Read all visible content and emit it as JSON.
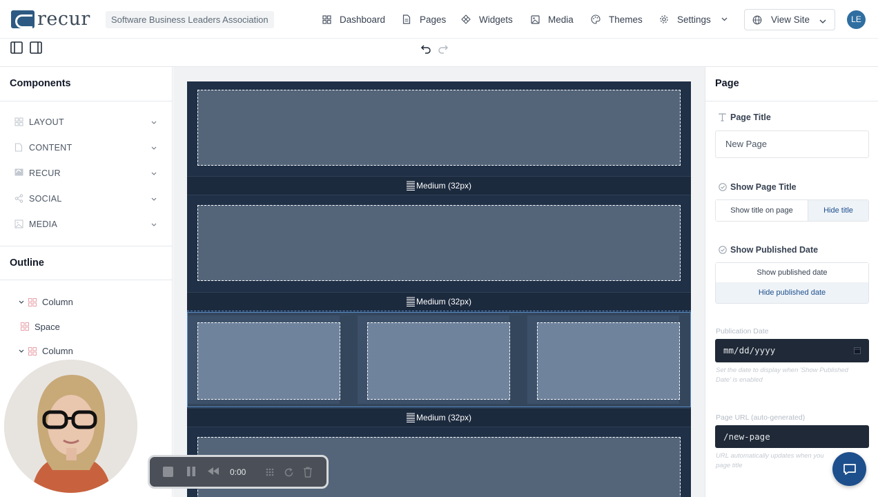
{
  "brand": {
    "logo_text": "recur",
    "org_name": "Software Business Leaders Association"
  },
  "nav": {
    "dashboard": "Dashboard",
    "pages": "Pages",
    "widgets": "Widgets",
    "media": "Media",
    "themes": "Themes",
    "settings": "Settings",
    "view_site": "View Site",
    "avatar_initials": "LE"
  },
  "left_panel": {
    "components_title": "Components",
    "components": [
      {
        "label": "LAYOUT",
        "icon": "layout-grid-icon"
      },
      {
        "label": "CONTENT",
        "icon": "document-icon"
      },
      {
        "label": "RECUR",
        "icon": "recur-icon"
      },
      {
        "label": "SOCIAL",
        "icon": "share-icon"
      },
      {
        "label": "MEDIA",
        "icon": "image-icon"
      }
    ],
    "outline_title": "Outline",
    "outline": [
      {
        "label": "Column",
        "expandable": true
      },
      {
        "label": "Space",
        "expandable": false
      },
      {
        "label": "Column",
        "expandable": true
      }
    ]
  },
  "canvas": {
    "spacer_label": "Medium (32px)"
  },
  "right_panel": {
    "title": "Page",
    "page_title_label": "Page Title",
    "page_title_value": "New Page",
    "show_page_title_label": "Show Page Title",
    "show_title_option": "Show title on page",
    "hide_title_option": "Hide title",
    "show_published_date_label": "Show Published Date",
    "show_published_option": "Show published date",
    "hide_published_option": "Hide published date",
    "publication_date_label": "Publication Date",
    "publication_date_placeholder": "mm/dd/yyyy",
    "publication_date_help": "Set the date to display when 'Show Published Date' is enabled",
    "page_url_label": "Page URL (auto-generated)",
    "page_url_value": "/new-page",
    "page_url_help_1": "URL automatically updates when you",
    "page_url_help_2": "page title"
  },
  "recorder": {
    "time": "0:00"
  },
  "colors": {
    "accent": "#1d4f8c",
    "canvas_dark": "#1f3047",
    "selection": "#5b8fc9"
  }
}
